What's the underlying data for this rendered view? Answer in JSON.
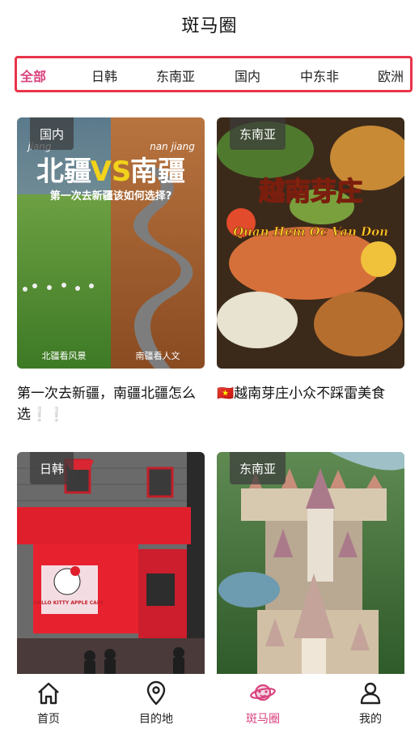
{
  "header": {
    "title": "斑马圈"
  },
  "tabs": [
    {
      "label": "全部",
      "active": true
    },
    {
      "label": "日韩",
      "active": false
    },
    {
      "label": "东南亚",
      "active": false
    },
    {
      "label": "国内",
      "active": false
    },
    {
      "label": "中东非",
      "active": false
    },
    {
      "label": "欧洲",
      "active": false
    }
  ],
  "cards": [
    {
      "badge": "国内",
      "caption": "第一次去新疆，南疆北疆怎么选",
      "caption_suffix": "❕❕",
      "image_text": {
        "left_title": "北疆",
        "vs": "VS",
        "right_title": "南疆",
        "left_pinyin": "jiang",
        "right_pinyin": "nan jiang",
        "subtitle": "第一次去新疆该如何选择?",
        "left_footer": "北疆看风景",
        "right_footer": "南疆看人文"
      }
    },
    {
      "badge": "东南亚",
      "caption": "越南芽庄小众不踩雷美食",
      "caption_prefix": "🇻🇳",
      "image_text": {
        "title": "越南芽庄",
        "subtitle": "Quan Hem Oc Van Don"
      }
    },
    {
      "badge": "日韩",
      "image_text": {
        "sign": "HELLO KITTY APPLE CAFE"
      }
    },
    {
      "badge": "东南亚"
    }
  ],
  "bottom_nav": [
    {
      "label": "首页",
      "icon": "home-icon",
      "active": false
    },
    {
      "label": "目的地",
      "icon": "location-pin-icon",
      "active": false
    },
    {
      "label": "斑马圈",
      "icon": "planet-icon",
      "active": true
    },
    {
      "label": "我的",
      "icon": "user-icon",
      "active": false
    }
  ],
  "colors": {
    "accent": "#d9427e",
    "tab_border": "#e8354a",
    "badge_bg": "#3c3c3c"
  }
}
